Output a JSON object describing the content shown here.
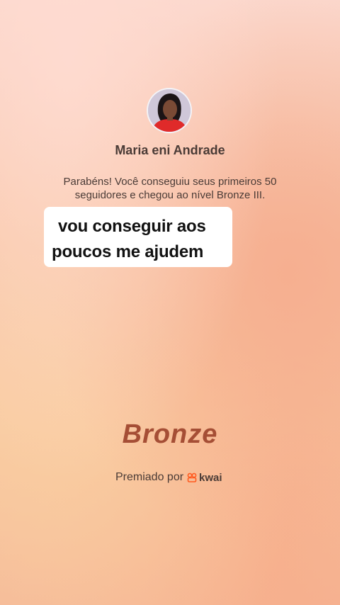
{
  "profile": {
    "name": "Maria eni Andrade"
  },
  "achievement": {
    "message": "Parabéns! Você conseguiu seus primeiros 50 seguidores e chegou ao nível Bronze III.",
    "level": "Bronze"
  },
  "caption": {
    "line1": "vou conseguir aos",
    "line2": "poucos me ajudem"
  },
  "footer": {
    "awarded_by": "Premiado por",
    "brand": "kwai",
    "brand_icon": "kwai-logo-icon"
  },
  "colors": {
    "level_text": "#a54e35",
    "brand_orange": "#ff5a1f",
    "primary_text": "#4a3b36"
  }
}
